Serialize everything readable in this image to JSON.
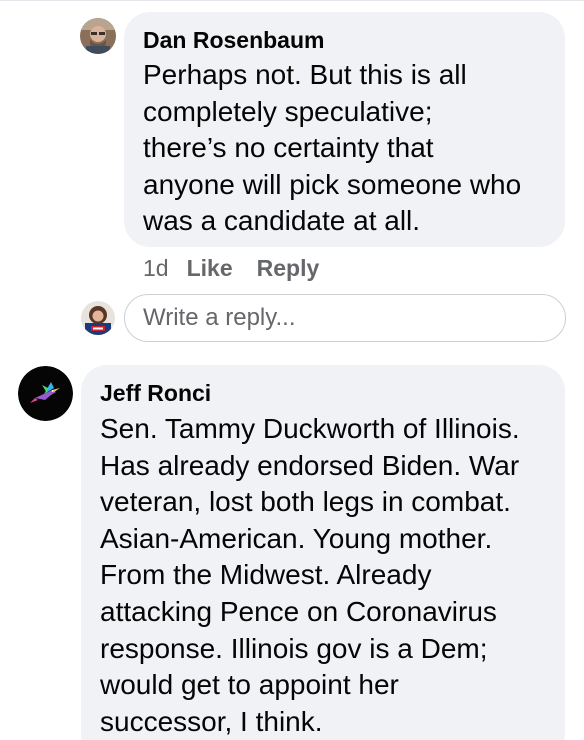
{
  "comments": [
    {
      "author": "Dan Rosenbaum",
      "lines": [
        "Perhaps not. But this is all",
        "completely speculative;",
        "there’s no certainty that",
        "anyone will pick someone who",
        "was a candidate at all."
      ],
      "age": "1d",
      "like_label": "Like",
      "reply_label": "Reply"
    },
    {
      "author": "Jeff Ronci",
      "lines": [
        "Sen. Tammy Duckworth of Illinois.",
        "Has already endorsed Biden. War",
        "veteran, lost both legs in combat.",
        "Asian-American. Young mother.",
        "From the Midwest. Already",
        "attacking Pence on Coronavirus",
        "response. Illinois gov is a Dem;",
        "would get to appoint her",
        "successor, I think."
      ]
    }
  ],
  "reply_input": {
    "placeholder": "Write a reply...",
    "value": ""
  },
  "colors": {
    "bubble": "#f0f2f5",
    "secondary_text": "#65676b",
    "primary_text": "#050505",
    "input_border": "#ccd0d5"
  },
  "icons": [
    "hummingbird-icon"
  ]
}
